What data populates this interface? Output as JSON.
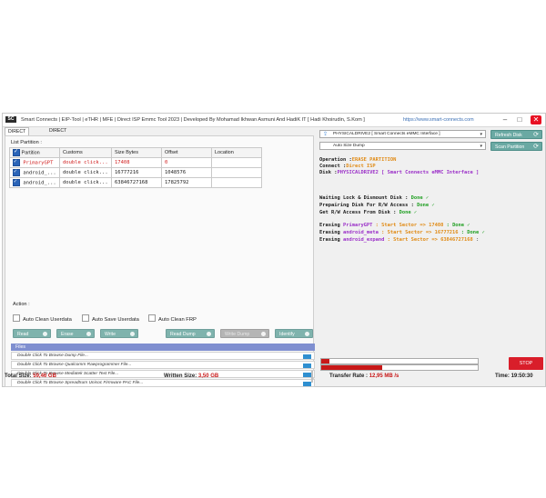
{
  "window": {
    "logo": "SC",
    "title": "Smart Connects | EIP-Tool | eTHR | MFE | Direct ISP Emmc Tool 2023 | Developed By Mohamad Ikhwan Asmuni And HadiK IT [ Hadi Khoirudin, S.Kom ]",
    "site": "https://www.smart-connects.com",
    "controls": {
      "minimize": "–",
      "maximize": "□",
      "close": "✕"
    }
  },
  "tabs": [
    "DIRECT FLASH",
    "DIRECT PINOUT"
  ],
  "partitions": {
    "caption": "List Partition :",
    "columns": [
      "Partition",
      "Customs",
      "Size Bytes",
      "Offset",
      "Location"
    ],
    "rows": [
      {
        "partition": "PrimaryGPT",
        "customs": "double click...",
        "size": "17408",
        "offset": "0",
        "location": "",
        "highlight": true
      },
      {
        "partition": "android_...",
        "customs": "double click...",
        "size": "16777216",
        "offset": "1048576",
        "location": "",
        "highlight": false
      },
      {
        "partition": "android_...",
        "customs": "double click...",
        "size": "63846727168",
        "offset": "17825792",
        "location": "",
        "highlight": false
      }
    ]
  },
  "action": {
    "caption": "Action :",
    "options": [
      "Auto Clean Userdata",
      "Auto Save Userdata",
      "Auto Clean FRP"
    ],
    "buttons": [
      "Read",
      "Erase",
      "Write",
      "Read Dump",
      "Write Dump",
      "Identify"
    ],
    "files_header": "Files",
    "files": [
      "Double Click To Browse Dump File...",
      "Double Click To Browse Qualcomm Rawprogrammer File...",
      "Double Click To Browse Mediatek Scatter Text File...",
      "Double Click To Browse Spreadtrum Unisoc Firmware PAC File..."
    ]
  },
  "device": {
    "disk_select": "PHYSICALDRIVE2 [ Smart Connects eMMC Interface ]",
    "mode_select": "Auto Size Dump",
    "refresh_label": "Refresh Disk",
    "scan_label": "Scan Partition"
  },
  "log": {
    "operation_label": "Operation  :",
    "operation_value": "ERASE PARTITION",
    "connect_label": "Connect    :",
    "connect_value": "Direct ISP",
    "disk_label": "Disk       :",
    "disk_value": "PHYSICALDRIVE2 [ Smart Connects eMMC Interface ]",
    "lines": [
      {
        "text": "Waiting Lock & Dismount Disk  : ",
        "status": "Done ✓"
      },
      {
        "text": "Prepairing Disk For R/W Access : ",
        "status": "Done ✓"
      },
      {
        "text": "Get R/W Access From Disk      : ",
        "status": "Done ✓"
      }
    ],
    "erase": [
      {
        "label": "Erasing ",
        "name": "PrimaryGPT",
        "sector": " : Start Sector => 17408",
        "status": " : Done ✓"
      },
      {
        "label": "Erasing ",
        "name": "android_meta",
        "sector": " : Start Sector => 16777216",
        "status": " : Done ✓"
      },
      {
        "label": "Erasing ",
        "name": "android_expand",
        "sector": " : Start Sector => 63846727168",
        "status": " : "
      }
    ]
  },
  "progress": {
    "primary": 0.05,
    "secondary": 0.39
  },
  "stop_label": "STOP",
  "status": {
    "total_label": "Total Size:",
    "total_value": "59,46 GB",
    "written_label": "Written Size:",
    "written_value": "3,50 GB",
    "rate_label": "Transfer Rate :",
    "rate_value": "12,95 MB /s",
    "time_label": "Time:",
    "time_value": "19:50:30"
  },
  "colors": {
    "accent": "#7fb3ad",
    "danger": "#d91e2a",
    "files_header": "#7f8fd0"
  }
}
